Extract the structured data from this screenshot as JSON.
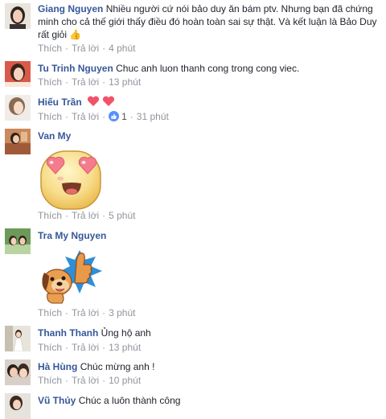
{
  "ui": {
    "like_label": "Thích",
    "reply_label": "Trả lời",
    "separator": "·"
  },
  "comments": [
    {
      "author": "Giang Nguyen",
      "text": "Nhiều người cứ nói bảo duy ăn bám ptv. Nhưng bạn đã chứng minh cho cả thế giới thấy điều đó hoàn toàn sai sự thật. Và kết luận là Bảo Duy rất giỏi",
      "emoji": "👍",
      "time": "4 phút"
    },
    {
      "author": "Tu Trinh Nguyen",
      "text": "Chuc anh luon thanh cong trong cong viec.",
      "time": "13 phút"
    },
    {
      "author": "Hiếu Trần",
      "text": "",
      "like_count": "1",
      "time": "31 phút"
    },
    {
      "author": "Van My",
      "text": "",
      "sticker": "heart-eyes-face-sticker",
      "time": "5 phút"
    },
    {
      "author": "Tra My Nguyen",
      "text": "",
      "sticker": "dog-thumbs-up-sticker",
      "time": "3 phút"
    },
    {
      "author": "Thanh Thanh",
      "text": "Ủng hộ anh",
      "time": "13 phút"
    },
    {
      "author": "Hà Hùng",
      "text": "Chúc mừng anh !",
      "time": "10 phút"
    },
    {
      "author": "Vũ Thủy",
      "text": "Chúc a luôn thành công"
    }
  ],
  "colors": {
    "name": "#365899",
    "meta": "#90949c",
    "like_badge": "#5890ff",
    "heart": "#f25268"
  }
}
